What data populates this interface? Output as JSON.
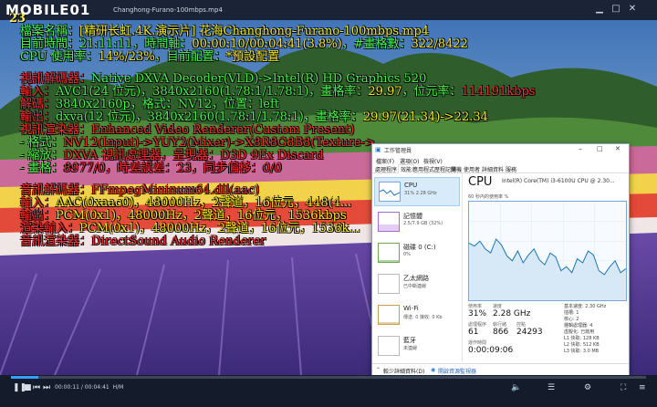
{
  "player": {
    "logo_text": "MOBILE01",
    "filename": "Changhong-Furano-100mbps.mp4",
    "time_display": "00:00:11 / 00:04:41",
    "format_tag": "H/M"
  },
  "osd": {
    "frame_counter": "23",
    "line1_label": "檔案名稱：",
    "line1_value": "[精研长虹.4K.演示片] 花海Changhong-Furano-100mbps.mp4",
    "line2_label": "目前時間：",
    "line2_clock": "21:11:11",
    "line2_mid": "，時間軸：",
    "line2_value": "00:00:10/00:04:41(3.8%)",
    "line2_frames_label": "，#畫格數：",
    "line2_frames": "322/8422",
    "line3_label": "CPU 使用率：",
    "line3_value": "14%/23%",
    "line3_mid": "，目前配置：",
    "line3_profile": "*預設配置",
    "line4_label": "視訊解碼器：",
    "line4_value": "Native DXVA Decoder(VLD)->Intel(R) HD Graphics 520",
    "line5_label": "輸入：",
    "line5_value": "AVC1(24 位元)，3840x2160(1.78:1/1.78:1)，畫格率：",
    "line5_fps": "29.97",
    "line5_br_label": "，位元率：",
    "line5_br": "114191kbps",
    "line6_label": "解碼：",
    "line6_value": "3840x2160p，格式：NV12，位置：left",
    "line7_label": "輸出：",
    "line7_value": "dxva(12 位元)，3840x2160(1.78:1/1.78:1)，畫格率：",
    "line7_fps": "29.97(21.34)->22.34",
    "line8_label": "視訊渲染器：",
    "line8_value": "Enhanced Video Renderer(Custom Present)",
    "line9_label": " - 格式：",
    "line9_value": "NV12(Input)->YUY2(Mixer)->X8R8G8B8(Texture->...",
    "line10_label": " - 縮放：",
    "line10_value": "DXVA 視訊處理器，呈現器：D3D 9Ex Discard",
    "line11_label": " - 畫格：",
    "line11_value": "8977/0，時差誤差：23，同步偏移：0/0",
    "line12_label": "音訊解碼器：",
    "line12_value": "FFmpegMininum64.dll(aac)",
    "line13_label": "輸入：",
    "line13_value": "AAC(0xaac0)，48000Hz，2聲道，16位元，448(4...",
    "line14_label": "輸出：",
    "line14_value": "PCM(0x1)，48000Hz，2聲道，16位元，1536kbps",
    "line15_label": "渲染輸入：",
    "line15_value": "PCM(0x1)，48000Hz，2聲道，16位元，1536k...",
    "line16_label": "音訊渲染器：",
    "line16_value": "DirectSound Audio Renderer"
  },
  "taskmgr": {
    "title": "工作管理員",
    "menu": [
      "檔案(F)",
      "選項(O)",
      "檢視(V)"
    ],
    "tabs": [
      "處理程序",
      "效能",
      "應用程式歷程記錄",
      "開機",
      "使用者",
      "詳細資料",
      "服務"
    ],
    "resources": [
      {
        "name": "CPU",
        "sub": "31% 2.28 GHz"
      },
      {
        "name": "記憶體",
        "sub": "2.5/7.9 GB (32%)"
      },
      {
        "name": "磁碟 0 (C:)",
        "sub": "0%"
      },
      {
        "name": "乙太網路",
        "sub": "已中斷連線"
      },
      {
        "name": "Wi-Fi",
        "sub": "傳送: 0 接收: 0 Kb"
      },
      {
        "name": "藍牙",
        "sub": "未連線"
      }
    ],
    "cpu_heading": "CPU",
    "cpu_model": "Intel(R) Core(TM) i3-6100U CPU @ 2.30...",
    "graph_label": "60 秒內的使用率 %",
    "stats": {
      "util_label": "使用率",
      "util": "31%",
      "speed_label": "速度",
      "speed": "2.28 GHz",
      "proc_label": "處理程序",
      "proc": "61",
      "thread_label": "執行緒",
      "thread": "866",
      "handle_label": "控點",
      "handle": "24293",
      "uptime_label": "運作時間",
      "uptime": "0:00:09:06"
    },
    "specs": [
      "基本速度: 2.30 GHz",
      "插槽: 1",
      "核心: 2",
      "邏輯處理器: 4",
      "虛擬化: 已啟用",
      "L1 快取: 128 KB",
      "L2 快取: 512 KB",
      "L3 快取: 3.0 MB"
    ],
    "footer_left": "較少詳細資料(D)",
    "footer_right": "開啟資源監視器",
    "colors": {
      "graph_line": "#1b75bb",
      "graph_fill": "#d7e9f7"
    },
    "cpu_series": [
      58,
      55,
      60,
      52,
      48,
      62,
      56,
      45,
      40,
      50,
      38,
      46,
      52,
      41,
      36,
      48,
      44,
      30,
      34,
      28,
      42,
      38,
      50,
      46,
      30,
      26,
      34,
      40,
      28,
      32
    ]
  }
}
